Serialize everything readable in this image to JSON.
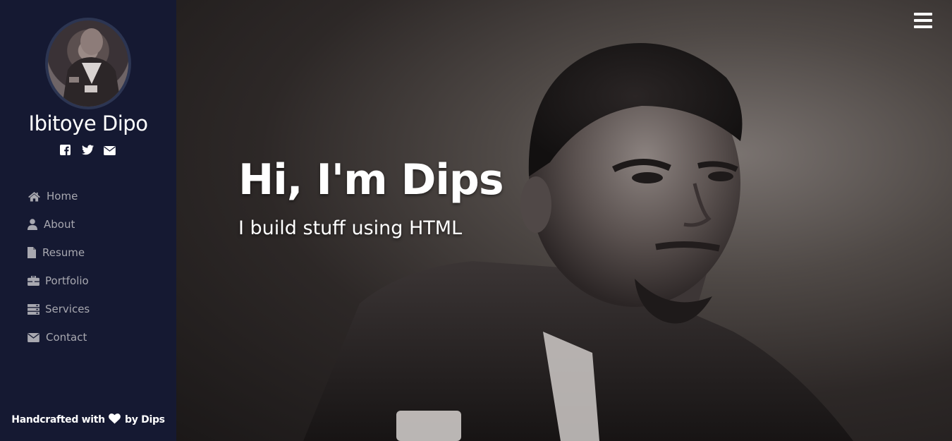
{
  "sidebar": {
    "profile_name": "Ibitoye Dipo",
    "social": [
      {
        "icon": "facebook-icon"
      },
      {
        "icon": "twitter-icon"
      },
      {
        "icon": "envelope-icon"
      }
    ],
    "nav": [
      {
        "label": "Home",
        "icon": "home-icon"
      },
      {
        "label": "About",
        "icon": "user-icon"
      },
      {
        "label": "Resume",
        "icon": "file-icon"
      },
      {
        "label": "Portfolio",
        "icon": "briefcase-icon"
      },
      {
        "label": "Services",
        "icon": "server-icon"
      },
      {
        "label": "Contact",
        "icon": "envelope-icon"
      }
    ],
    "footer": {
      "prefix": "Handcrafted with",
      "suffix": "by Dips",
      "icon": "heart-icon"
    }
  },
  "hero": {
    "title": "Hi, I'm Dips",
    "subtitle": "I build stuff using HTML",
    "menu_icon": "hamburger-icon"
  },
  "colors": {
    "sidebar_bg": "#151932",
    "avatar_border": "#2c3552",
    "nav_text": "#a8a8b0",
    "white": "#ffffff"
  }
}
